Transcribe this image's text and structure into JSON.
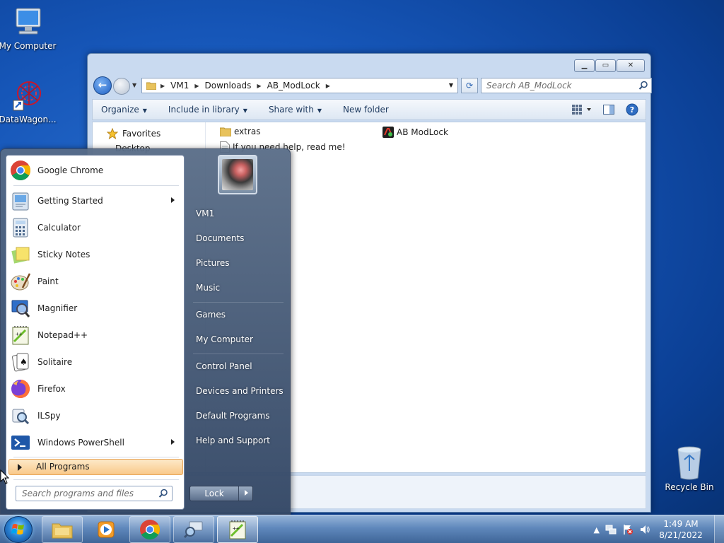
{
  "desktop": {
    "icons": [
      {
        "label": "My Computer"
      },
      {
        "label": "DataWagon..."
      },
      {
        "label": "Recycle Bin"
      }
    ]
  },
  "explorer": {
    "breadcrumb": [
      "VM1",
      "Downloads",
      "AB_ModLock"
    ],
    "search_placeholder": "Search AB_ModLock",
    "toolbar": {
      "organize": "Organize",
      "include_in_library": "Include in library",
      "share_with": "Share with",
      "new_folder": "New folder"
    },
    "nav_pane": {
      "favorites": "Favorites",
      "desktop_partial": "Desktop"
    },
    "files": [
      {
        "name": "extras",
        "type": "folder"
      },
      {
        "name": "AB ModLock",
        "type": "application"
      },
      {
        "name": "If you need help, read me!",
        "type": "text"
      }
    ]
  },
  "start_menu": {
    "programs": [
      {
        "name": "Google Chrome",
        "icon": "chrome-icon",
        "submenu": false
      },
      {
        "name": "Getting Started",
        "icon": "getting-started-icon",
        "submenu": true
      },
      {
        "name": "Calculator",
        "icon": "calculator-icon",
        "submenu": false
      },
      {
        "name": "Sticky Notes",
        "icon": "sticky-notes-icon",
        "submenu": false
      },
      {
        "name": "Paint",
        "icon": "paint-icon",
        "submenu": false
      },
      {
        "name": "Magnifier",
        "icon": "magnifier-icon",
        "submenu": false
      },
      {
        "name": "Notepad++",
        "icon": "notepadpp-icon",
        "submenu": false
      },
      {
        "name": "Solitaire",
        "icon": "solitaire-icon",
        "submenu": false
      },
      {
        "name": "Firefox",
        "icon": "firefox-icon",
        "submenu": false
      },
      {
        "name": "ILSpy",
        "icon": "ilspy-icon",
        "submenu": false
      },
      {
        "name": "Windows PowerShell",
        "icon": "powershell-icon",
        "submenu": true
      }
    ],
    "all_programs": "All Programs",
    "search_placeholder": "Search programs and files",
    "right_items": [
      "VM1",
      "Documents",
      "Pictures",
      "Music",
      "Games",
      "My Computer",
      "Control Panel",
      "Devices and Printers",
      "Default Programs",
      "Help and Support"
    ],
    "lock_label": "Lock"
  },
  "taskbar": {
    "clock_time": "1:49 AM",
    "clock_date": "8/21/2022"
  }
}
